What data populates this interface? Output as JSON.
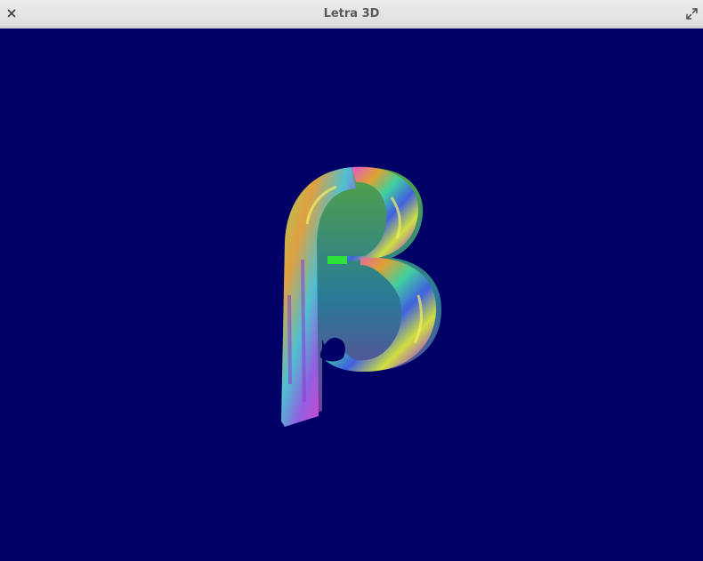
{
  "window": {
    "title": "Letra 3D",
    "close_icon": "close-icon",
    "maximize_icon": "maximize-icon"
  },
  "scene": {
    "background_color": "#000066",
    "glyph": "β",
    "surface": "multicolor-rainbow-texture"
  }
}
